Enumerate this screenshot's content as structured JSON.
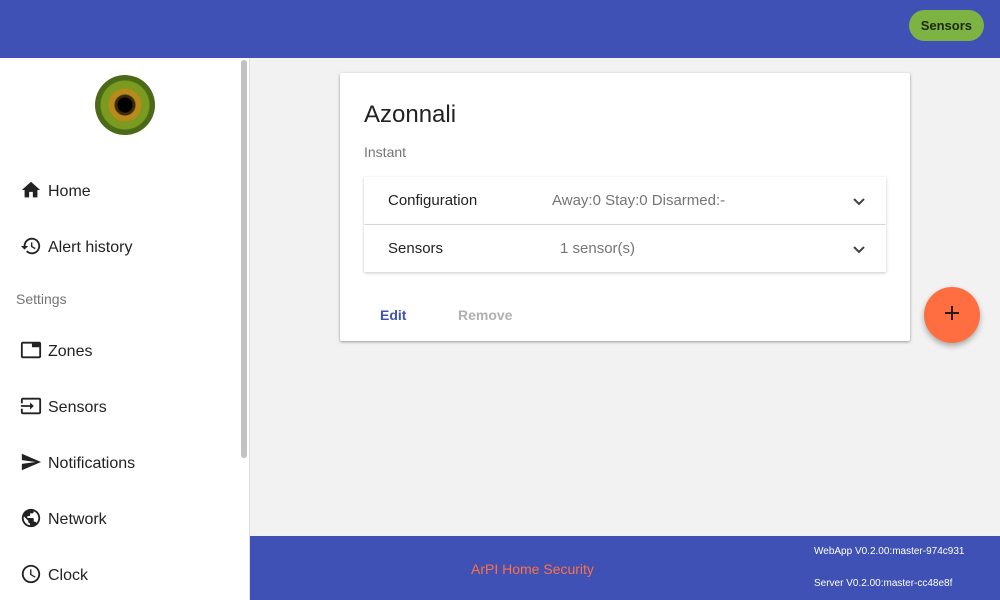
{
  "header": {
    "sensors_chip": "Sensors"
  },
  "sidebar": {
    "items": [
      {
        "label": "Home",
        "icon": "home-icon"
      },
      {
        "label": "Alert history",
        "icon": "history-icon"
      },
      {
        "label": "Zones",
        "icon": "zones-icon"
      },
      {
        "label": "Sensors",
        "icon": "sensors-input-icon"
      },
      {
        "label": "Notifications",
        "icon": "send-icon"
      },
      {
        "label": "Network",
        "icon": "globe-icon"
      },
      {
        "label": "Clock",
        "icon": "clock-icon"
      }
    ],
    "section_label": "Settings"
  },
  "card": {
    "title": "Azonnali",
    "subtitle": "Instant",
    "panels": [
      {
        "label": "Configuration",
        "summary": "Away:0 Stay:0 Disarmed:-"
      },
      {
        "label": "Sensors",
        "summary": "1 sensor(s)"
      }
    ],
    "actions": {
      "edit": "Edit",
      "remove": "Remove"
    }
  },
  "footer": {
    "title": "ArPI Home Security",
    "webapp_version": "WebApp V0.2.00:master-974c931",
    "server_version": "Server V0.2.00:master-cc48e8f"
  },
  "colors": {
    "primary": "#3f51b5",
    "accent": "#ff6e40",
    "chip": "#7cb342"
  }
}
